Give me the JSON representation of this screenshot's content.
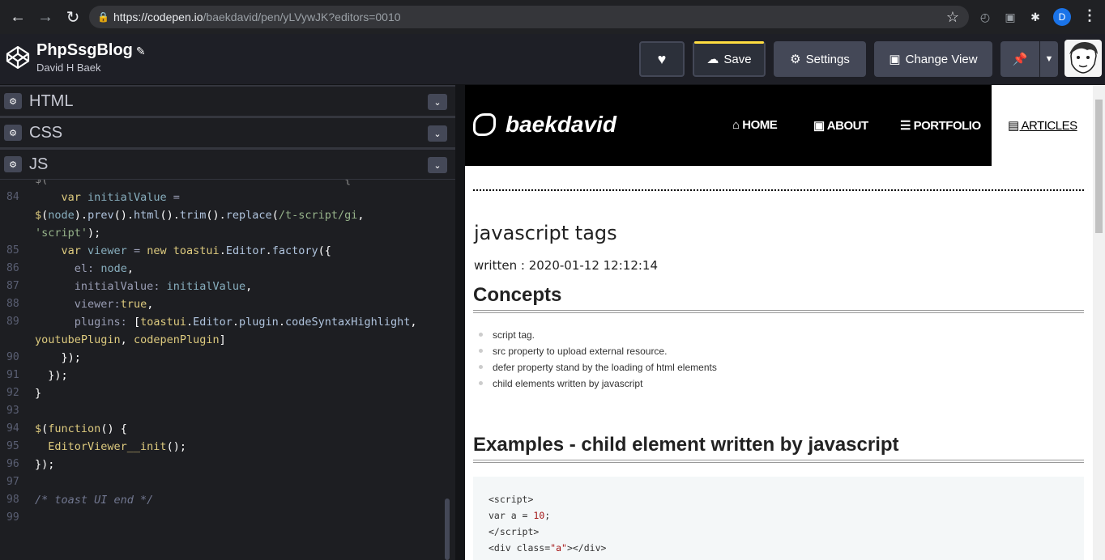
{
  "browser": {
    "url_host": "https://codepen.io",
    "url_path": "/baekdavid/pen/yLVywJK?editors=0010",
    "profile_initial": "D",
    "icons": [
      "back-icon",
      "forward-icon",
      "reload-icon",
      "lock-icon",
      "star-icon",
      "extension-icon",
      "menu-icon"
    ]
  },
  "header": {
    "pen_title": "PhpSsgBlog",
    "author": "David H Baek",
    "buttons": {
      "save": "Save",
      "settings": "Settings",
      "change_view": "Change View"
    },
    "accent_color": "#ffdd40"
  },
  "editor": {
    "panels": [
      {
        "label": "HTML"
      },
      {
        "label": "CSS"
      },
      {
        "label": "JS"
      }
    ],
    "lines": [
      {
        "n": "84"
      },
      {
        "n": ""
      },
      {
        "n": ""
      },
      {
        "n": "85"
      },
      {
        "n": "86"
      },
      {
        "n": "87"
      },
      {
        "n": "88"
      },
      {
        "n": "89"
      },
      {
        "n": ""
      },
      {
        "n": "90"
      },
      {
        "n": "91"
      },
      {
        "n": "92"
      },
      {
        "n": "93"
      },
      {
        "n": "94"
      },
      {
        "n": "95"
      },
      {
        "n": "96"
      },
      {
        "n": "97"
      },
      {
        "n": "98"
      },
      {
        "n": "99"
      }
    ]
  },
  "preview": {
    "site_name": "baekdavid",
    "nav": [
      "HOME",
      "ABOUT",
      "PORTFOLIO",
      "ARTICLES"
    ],
    "article_title": "javascript tags",
    "written": "written : 2020-01-12 12:12:14",
    "section1": "Concepts",
    "bullets": [
      "script tag.",
      "src property to upload external resource.",
      "defer property stand by the loading of html elements",
      "child elements written by javascript"
    ],
    "section2": "Examples - child element written by javascript"
  }
}
